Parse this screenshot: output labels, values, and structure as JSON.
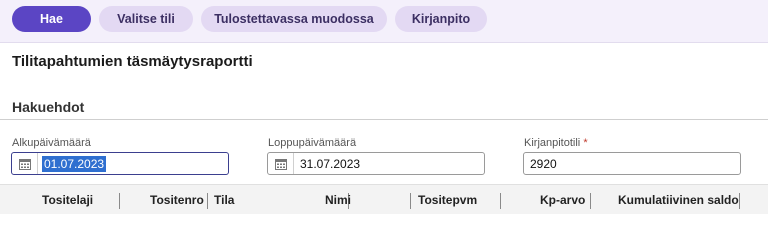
{
  "toolbar": {
    "buttons": [
      {
        "label": "Hae",
        "active": true
      },
      {
        "label": "Valitse tili",
        "active": false
      },
      {
        "label": "Tulostettavassa muodossa",
        "active": false
      },
      {
        "label": "Kirjanpito",
        "active": false
      }
    ]
  },
  "page": {
    "title": "Tilitapahtumien täsmäytysraportti",
    "section_title": "Hakuehdot"
  },
  "fields": {
    "start_date": {
      "label": "Alkupäivämäärä",
      "value": "01.07.2023",
      "icon": "calendar-icon"
    },
    "end_date": {
      "label": "Loppupäivämäärä",
      "value": "31.07.2023",
      "icon": "calendar-icon"
    },
    "account": {
      "label": "Kirjanpitotili",
      "required_marker": "*",
      "value": "2920"
    }
  },
  "table": {
    "columns": [
      "Tositelaji",
      "Tositenro",
      "Tila",
      "Nimi",
      "Tositepvm",
      "Kp-arvo",
      "Kumulatiivinen saldo"
    ]
  },
  "colors": {
    "accent": "#5b45c4",
    "button_bg": "#e3d9f3",
    "required": "#c0392b",
    "selection": "#2f6fd0"
  }
}
